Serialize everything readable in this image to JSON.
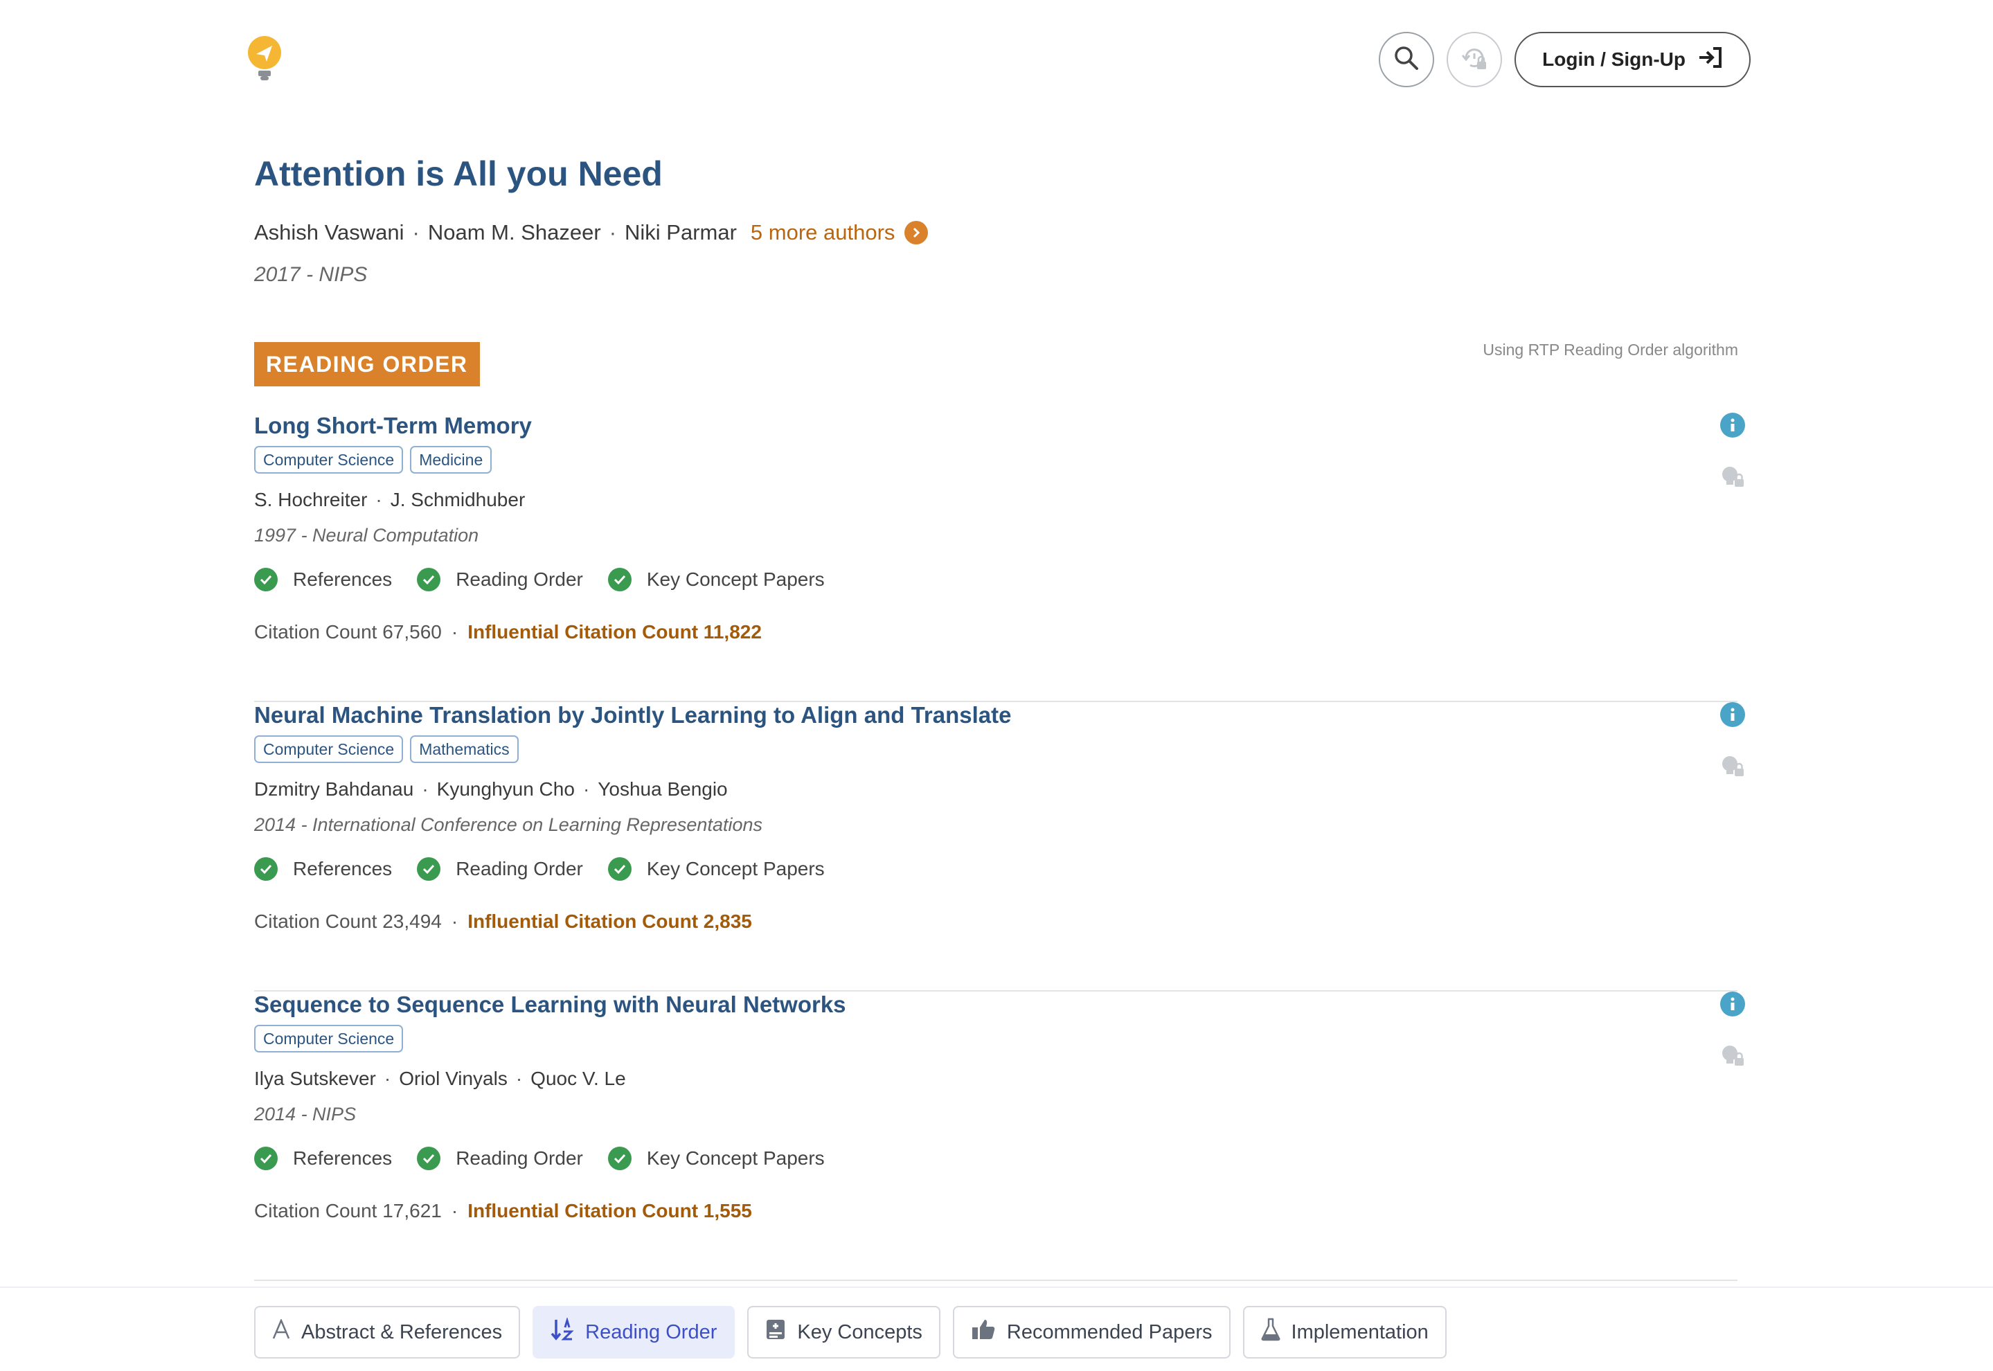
{
  "header": {
    "logo_icon": "lightbulb-navigation-icon",
    "search_icon": "search-icon",
    "history_icon": "history-lock-icon",
    "login_label": "Login / Sign-Up",
    "login_icon": "sign-in-icon"
  },
  "paper": {
    "title": "Attention is All you Need",
    "authors": [
      "Ashish Vaswani",
      "Noam M. Shazeer",
      "Niki Parmar"
    ],
    "more_authors": "5 more authors",
    "venue": "2017 - NIPS"
  },
  "section": {
    "badge": "READING ORDER",
    "algorithm_note": "Using RTP Reading Order algorithm"
  },
  "items": [
    {
      "title": "Long Short-Term Memory",
      "tags": [
        "Computer Science",
        "Medicine"
      ],
      "authors": [
        "S. Hochreiter",
        "J. Schmidhuber"
      ],
      "venue": "1997 - Neural Computation",
      "features": [
        "References",
        "Reading Order",
        "Key Concept Papers"
      ],
      "citation": "Citation Count 67,560",
      "influential": "Influential Citation Count 11,822"
    },
    {
      "title": "Neural Machine Translation by Jointly Learning to Align and Translate",
      "tags": [
        "Computer Science",
        "Mathematics"
      ],
      "authors": [
        "Dzmitry Bahdanau",
        "Kyunghyun Cho",
        "Yoshua Bengio"
      ],
      "venue": "2014 - International Conference on Learning Representations",
      "features": [
        "References",
        "Reading Order",
        "Key Concept Papers"
      ],
      "citation": "Citation Count 23,494",
      "influential": "Influential Citation Count 2,835"
    },
    {
      "title": "Sequence to Sequence Learning with Neural Networks",
      "tags": [
        "Computer Science"
      ],
      "authors": [
        "Ilya Sutskever",
        "Oriol Vinyals",
        "Quoc V. Le"
      ],
      "venue": "2014 - NIPS",
      "features": [
        "References",
        "Reading Order",
        "Key Concept Papers"
      ],
      "citation": "Citation Count 17,621",
      "influential": "Influential Citation Count 1,555"
    }
  ],
  "tabs": [
    {
      "label": "Abstract & References",
      "icon": "font-a-icon",
      "active": false
    },
    {
      "label": "Reading Order",
      "icon": "sort-order-icon",
      "active": true
    },
    {
      "label": "Key Concepts",
      "icon": "key-concepts-icon",
      "active": false
    },
    {
      "label": "Recommended Papers",
      "icon": "thumbs-up-icon",
      "active": false
    },
    {
      "label": "Implementation",
      "icon": "flask-icon",
      "active": false
    }
  ],
  "colors": {
    "title_blue": "#2b5580",
    "accent_orange": "#d9822b",
    "influential_brown": "#a35a09",
    "check_green": "#3a9a4f",
    "info_blue": "#4aa4c8",
    "active_tab_bg": "#e8ecfb",
    "active_tab_text": "#3d4fc4"
  }
}
